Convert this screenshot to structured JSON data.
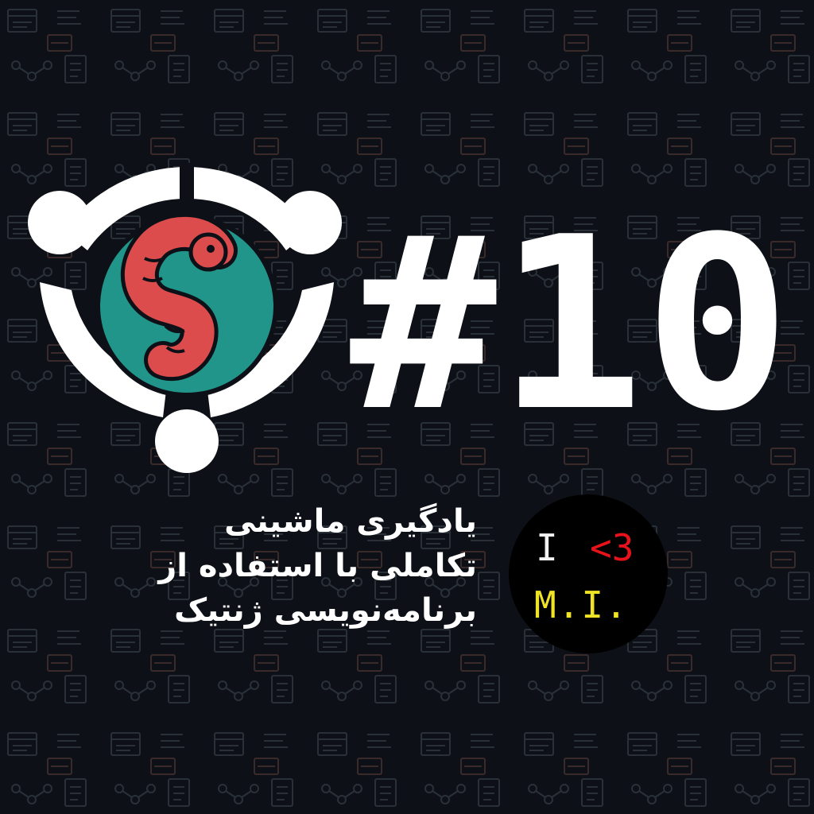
{
  "episode": {
    "number": "#10"
  },
  "title": {
    "lines": [
      "یادگیری ماشینی",
      "تکاملی با استفاده از",
      "برنامه‌نویسی ژنتیک"
    ]
  },
  "badge": {
    "i": "I",
    "heart": "<3",
    "mi": "M.I."
  },
  "icons": {
    "logo": "ubuntu-style-circle-of-friends-logo",
    "worm": "red-worm-icon",
    "background": "code-pattern-icons"
  },
  "colors": {
    "background": "#0d1117",
    "teal": "#21958a",
    "worm": "#dd4c4c",
    "white": "#ffffff",
    "heart_red": "#e8121b",
    "mi_yellow": "#f0e224"
  }
}
